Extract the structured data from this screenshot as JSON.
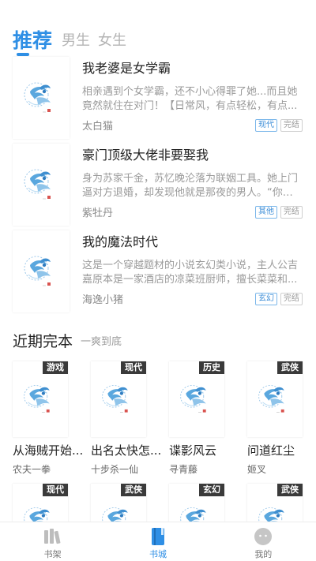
{
  "tabs": [
    {
      "label": "推荐",
      "active": true
    },
    {
      "label": "男生",
      "active": false
    },
    {
      "label": "女生",
      "active": false
    }
  ],
  "books": [
    {
      "title": "我老婆是女学霸",
      "desc": "相亲遇到个女学霸，还不小心得罪了她...而且她竟然就住在对门！【日常风，有点轻松，有点...",
      "author": "太白猫",
      "genre": "现代",
      "status": "完结"
    },
    {
      "title": "豪门顶级大佬非要娶我",
      "desc": "身为苏家千金，苏忆晚沦落为联姻工具。她上门逼对方退婚，却发现他就是那夜的男人。“你想...",
      "author": "紫牡丹",
      "genre": "其他",
      "status": "完结"
    },
    {
      "title": "我的魔法时代",
      "desc": "这是一个穿越题材的小说玄幻类小说，主人公吉嘉原本是一家酒店的凉菜班厨师，擅长菜菜和...",
      "author": "海逸小猪",
      "genre": "玄幻",
      "status": "完结"
    }
  ],
  "section": {
    "title": "近期完本",
    "subtitle": "一爽到底"
  },
  "grid": [
    {
      "title": "从海贼开始...",
      "author": "农夫一拳",
      "tag": "游戏"
    },
    {
      "title": "出名太快怎...",
      "author": "十步杀一仙",
      "tag": "现代"
    },
    {
      "title": "谍影风云",
      "author": "寻青藤",
      "tag": "历史"
    },
    {
      "title": "问道红尘",
      "author": "姬叉",
      "tag": "武侠"
    },
    {
      "title": "",
      "author": "",
      "tag": "现代"
    },
    {
      "title": "",
      "author": "",
      "tag": "武侠"
    },
    {
      "title": "",
      "author": "",
      "tag": "玄幻"
    },
    {
      "title": "",
      "author": "",
      "tag": "武侠"
    }
  ],
  "nav": [
    {
      "label": "书架",
      "icon": "bookshelf-icon",
      "active": false
    },
    {
      "label": "书城",
      "icon": "bookstore-icon",
      "active": true
    },
    {
      "label": "我的",
      "icon": "profile-icon",
      "active": false
    }
  ],
  "colors": {
    "accent": "#2f8fe5",
    "tag_dark": "#3a3a3a"
  }
}
